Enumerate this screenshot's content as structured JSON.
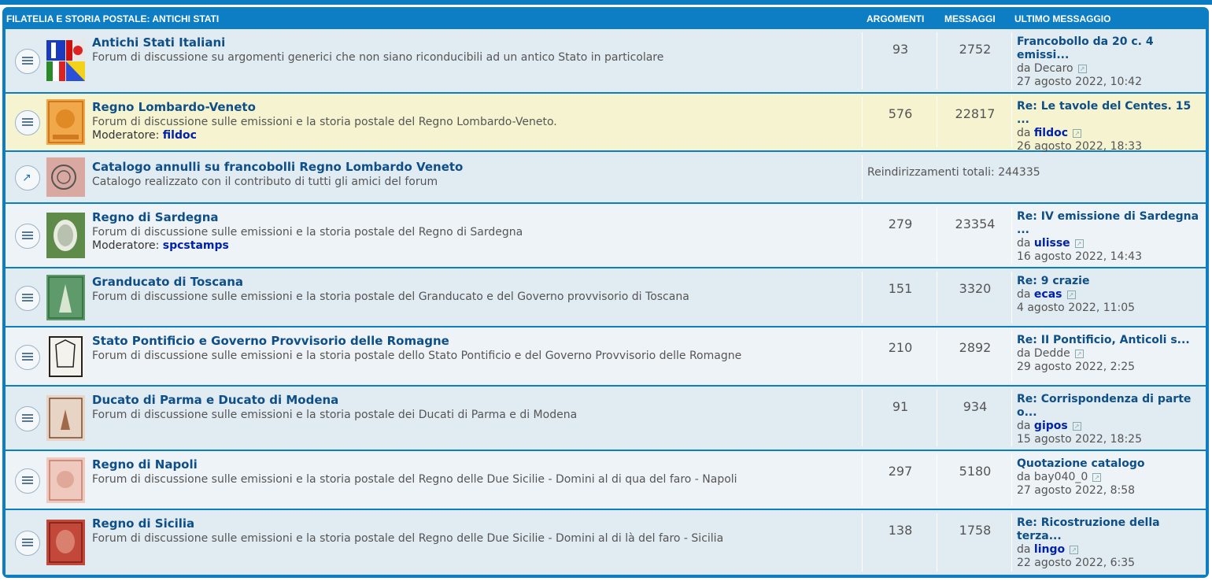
{
  "header": {
    "category": "FILATELIA E STORIA POSTALE: ANTICHI STATI",
    "col_topics": "ARGOMENTI",
    "col_posts": "MESSAGGI",
    "col_last": "ULTIMO MESSAGGIO"
  },
  "colors": {
    "header_bg": "#0d7ec4",
    "row": "#eef3f7",
    "row_alt": "#e1ebf2",
    "highlight": "#f6f4d0",
    "title": "#0e4f87",
    "username": "#0022aa"
  },
  "forums": [
    {
      "title": "Antichi Stati Italiani",
      "desc": "Forum di discussione su argomenti generici che non siano riconducibili ad un antico Stato in particolare",
      "topics": "93",
      "posts": "2752",
      "last_title": "Francobollo da 20 c. 4 emissi...",
      "last_by_prefix": "da",
      "last_user": "Decaro",
      "last_date": "27 agosto 2022, 10:42"
    },
    {
      "title": "Regno Lombardo-Veneto",
      "desc": "Forum di discussione sulle emissioni e la storia postale del Regno Lombardo-Veneto.",
      "mod_label": "Moderatore:",
      "mod_user": "fildoc",
      "topics": "576",
      "posts": "22817",
      "last_title": "Re: Le tavole del Centes. 15 ...",
      "last_by_prefix": "da",
      "last_user": "fildoc",
      "last_date": "26 agosto 2022, 18:33"
    },
    {
      "title": "Catalogo annulli su francobolli Regno Lombardo Veneto",
      "desc": "Catalogo realizzato con il contributo di tutti gli amici del forum",
      "redirect": "Reindirizzamenti totali: 244335"
    },
    {
      "title": "Regno di Sardegna",
      "desc": "Forum di discussione sulle emissioni e la storia postale del Regno di Sardegna",
      "mod_label": "Moderatore:",
      "mod_user": "spcstamps",
      "topics": "279",
      "posts": "23354",
      "last_title": "Re: IV emissione di Sardegna ...",
      "last_by_prefix": "da",
      "last_user": "ulisse",
      "last_date": "16 agosto 2022, 14:43"
    },
    {
      "title": "Granducato di Toscana",
      "desc": "Forum di discussione sulle emissioni e la storia postale del Granducato e del Governo provvisorio di Toscana",
      "topics": "151",
      "posts": "3320",
      "last_title": "Re: 9 crazie",
      "last_by_prefix": "da",
      "last_user": "ecas",
      "last_date": "4 agosto 2022, 11:05"
    },
    {
      "title": "Stato Pontificio e Governo Provvisorio delle Romagne",
      "desc": "Forum di discussione sulle emissioni e la storia postale dello Stato Pontificio e del Governo Provvisorio delle Romagne",
      "topics": "210",
      "posts": "2892",
      "last_title": "Re: II Pontificio, Anticoli s...",
      "last_by_prefix": "da",
      "last_user": "Dedde",
      "last_date": "29 agosto 2022, 2:25"
    },
    {
      "title": "Ducato di Parma e Ducato di Modena",
      "desc": "Forum di discussione sulle emissioni e la storia postale dei Ducati di Parma e di Modena",
      "topics": "91",
      "posts": "934",
      "last_title": "Re: Corrispondenza di parte o...",
      "last_by_prefix": "da",
      "last_user": "gipos",
      "last_date": "15 agosto 2022, 18:25"
    },
    {
      "title": "Regno di Napoli",
      "desc": "Forum di discussione sulle emissioni e la storia postale del Regno delle Due Sicilie - Domini al di qua del faro - Napoli",
      "topics": "297",
      "posts": "5180",
      "last_title": "Quotazione catalogo",
      "last_by_prefix": "da",
      "last_user": "bay040_0",
      "last_date": "27 agosto 2022, 8:58"
    },
    {
      "title": "Regno di Sicilia",
      "desc": "Forum di discussione sulle emissioni e la storia postale del Regno delle Due Sicilie - Domini al di là del faro - Sicilia",
      "topics": "138",
      "posts": "1758",
      "last_title": "Re: Ricostruzione della terza...",
      "last_by_prefix": "da",
      "last_user": "lingo",
      "last_date": "22 agosto 2022, 6:35"
    }
  ]
}
